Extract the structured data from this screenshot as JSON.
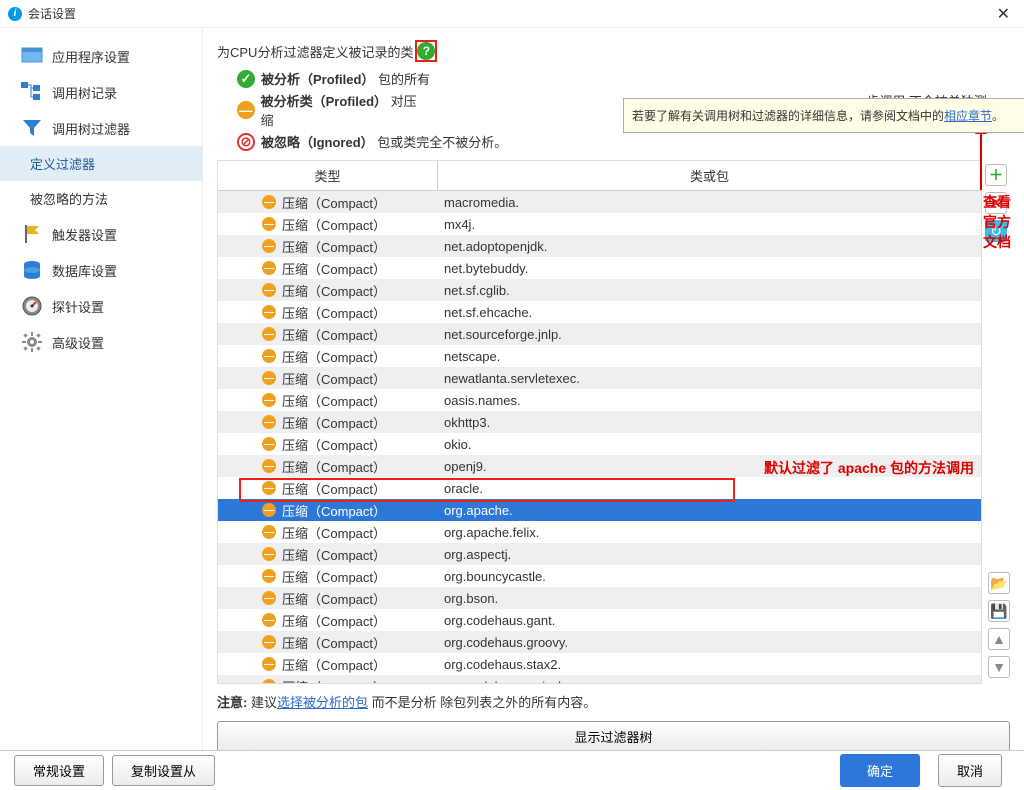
{
  "title": "会话设置",
  "sidebar": [
    {
      "label": "应用程序设置",
      "icon": "app"
    },
    {
      "label": "调用树记录",
      "icon": "tree"
    },
    {
      "label": "调用树过滤器",
      "icon": "filter"
    },
    {
      "label": "定义过滤器",
      "sub": true,
      "selected": true
    },
    {
      "label": "被忽略的方法",
      "sub": true
    },
    {
      "label": "触发器设置",
      "icon": "flag"
    },
    {
      "label": "数据库设置",
      "icon": "db"
    },
    {
      "label": "探针设置",
      "icon": "probe"
    },
    {
      "label": "高级设置",
      "icon": "gear"
    }
  ],
  "desc": "为CPU分析过滤器定义被记录的类",
  "legend": {
    "a": {
      "b": "被分析（Profiled）",
      "t": "包的所有"
    },
    "b": {
      "b": "被分析类（Profiled）",
      "t": "对压缩",
      "t2": "步调用 不会被单独测量。"
    },
    "c": {
      "b": "被忽略（Ignored）",
      "t": "包或类完全不被分析。"
    }
  },
  "tooltip": {
    "pre": "若要了解有关调用树和过滤器的详细信息，请参阅文档中的",
    "link": "相应章节",
    "post": "。"
  },
  "ann1": "查看官方文档",
  "ann2": "默认过滤了 apache 包的方法调用",
  "table": {
    "h1": "类型",
    "h2": "类或包",
    "type": "压缩（Compact）",
    "rows": [
      "macromedia.",
      "mx4j.",
      "net.adoptopenjdk.",
      "net.bytebuddy.",
      "net.sf.cglib.",
      "net.sf.ehcache.",
      "net.sourceforge.jnlp.",
      "netscape.",
      "newatlanta.servletexec.",
      "oasis.names.",
      "okhttp3.",
      "okio.",
      "openj9.",
      "oracle.",
      "org.apache.",
      "org.apache.felix.",
      "org.aspectj.",
      "org.bouncycastle.",
      "org.bson.",
      "org.codehaus.gant.",
      "org.codehaus.groovy.",
      "org.codehaus.stax2.",
      "org.codehaus.swizzle."
    ],
    "selectedIndex": 14
  },
  "note": {
    "pre": "注意: ",
    "t1": "建议",
    "link": "选择被分析的包",
    "t2": " 而不是分析 除包列表之外的所有内容。"
  },
  "showTree": "显示过滤器树",
  "footer": {
    "general": "常规设置",
    "copy": "复制设置从",
    "ok": "确定",
    "cancel": "取消"
  }
}
